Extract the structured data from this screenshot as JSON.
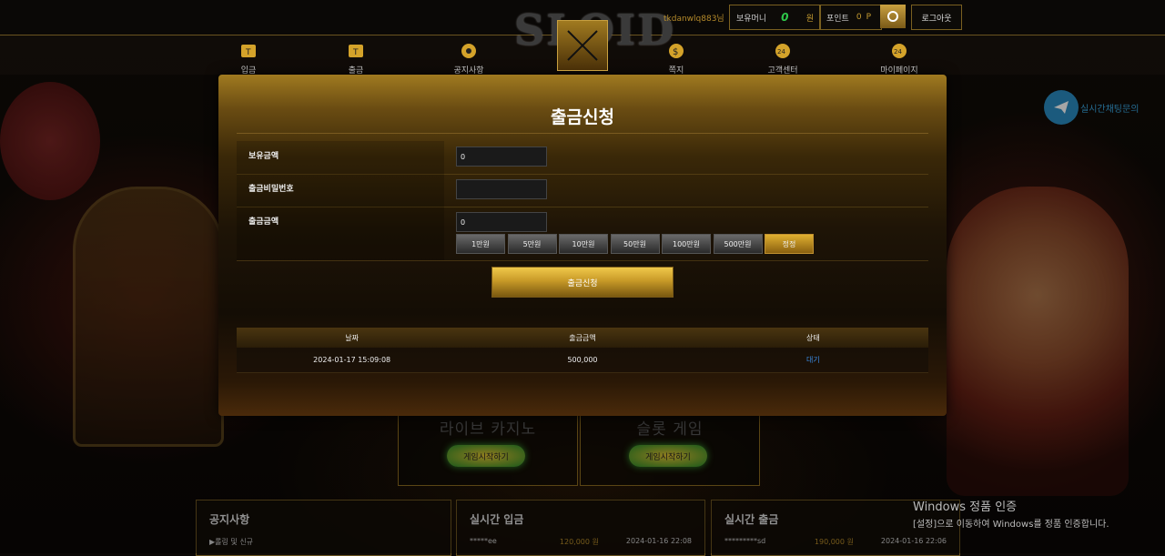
{
  "header": {
    "logo": "SLOID",
    "username": "tkdanwlq883님",
    "money_label": "보유머니",
    "money_value": "0",
    "money_unit": "원",
    "point_label": "포인트",
    "point_value": "0",
    "point_unit": "P",
    "logout_label": "로그아웃"
  },
  "nav": [
    {
      "label": "입금",
      "icon": "coin-icon"
    },
    {
      "label": "출금",
      "icon": "coin-out-icon"
    },
    {
      "label": "공지사항",
      "icon": "notice-icon"
    },
    {
      "label": "쪽지",
      "icon": "message-icon"
    },
    {
      "label": "고객센터",
      "icon": "support-24-icon"
    },
    {
      "label": "마이페이지",
      "icon": "mypage-24-icon"
    }
  ],
  "telegram": {
    "label": "실시간채팅문의",
    "icon": "telegram-icon"
  },
  "modal": {
    "title": "출금신청",
    "fields": {
      "balance_label": "보유금액",
      "balance_value": "0",
      "password_label": "출금비밀번호",
      "password_value": "",
      "amount_label": "출금금액",
      "amount_value": "0"
    },
    "amount_buttons": [
      "1만원",
      "5만원",
      "10만원",
      "50만원",
      "100만원",
      "500만원",
      "정정"
    ],
    "submit_label": "출금신청",
    "table": {
      "headers": [
        "날짜",
        "출금금액",
        "상태"
      ],
      "rows": [
        {
          "date": "2024-01-17 15:09:08",
          "amount": "500,000",
          "status": "대기"
        }
      ]
    }
  },
  "games": [
    {
      "title": "라이브 카지노",
      "button": "게임시작하기"
    },
    {
      "title": "슬롯 게임",
      "button": "게임시작하기"
    }
  ],
  "panels": {
    "notice": {
      "title": "공지사항",
      "item": "▶롤링 및 신규"
    },
    "deposit": {
      "title": "실시간 입금",
      "user": "*****ee",
      "amount": "120,000 원",
      "date": "2024-01-16 22:08"
    },
    "withdraw": {
      "title": "실시간 출금",
      "user": "*********sd",
      "amount": "190,000 원",
      "date": "2024-01-16 22:06"
    }
  },
  "watermark": {
    "title": "Windows 정품 인증",
    "subtitle": "[설정]으로 이동하여 Windows를 정품 인증합니다."
  },
  "colors": {
    "accent_gold": "#c89a28",
    "money_green": "#2ec84a",
    "status_blue": "#3a8ae0"
  }
}
